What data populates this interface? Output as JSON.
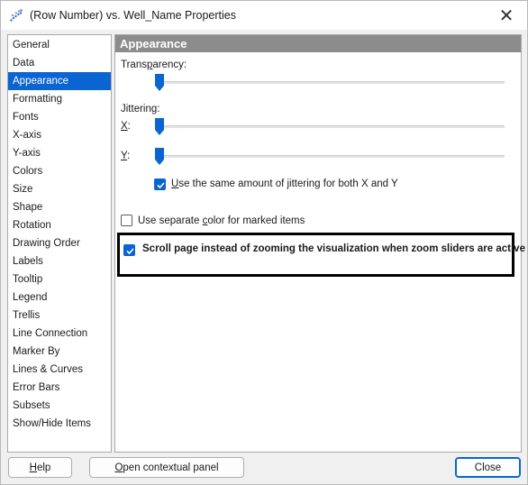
{
  "window": {
    "title": "(Row Number) vs. Well_Name Properties",
    "icon": "scatter-plot-icon",
    "close_glyph": "✕"
  },
  "nav": {
    "items": [
      {
        "label": "General"
      },
      {
        "label": "Data"
      },
      {
        "label": "Appearance",
        "selected": true
      },
      {
        "label": "Formatting"
      },
      {
        "label": "Fonts"
      },
      {
        "label": "X-axis"
      },
      {
        "label": "Y-axis"
      },
      {
        "label": "Colors"
      },
      {
        "label": "Size"
      },
      {
        "label": "Shape"
      },
      {
        "label": "Rotation"
      },
      {
        "label": "Drawing Order"
      },
      {
        "label": "Labels"
      },
      {
        "label": "Tooltip"
      },
      {
        "label": "Legend"
      },
      {
        "label": "Trellis"
      },
      {
        "label": "Line Connection"
      },
      {
        "label": "Marker By"
      },
      {
        "label": "Lines & Curves"
      },
      {
        "label": "Error Bars"
      },
      {
        "label": "Subsets"
      },
      {
        "label": "Show/Hide Items"
      }
    ]
  },
  "panel": {
    "header": "Appearance",
    "transparency": {
      "label_pre": "Trans",
      "label_ul": "p",
      "label_post": "arency:",
      "value": 0
    },
    "jittering": {
      "label": "Jittering:",
      "x_ul": "X",
      "x_post": ":",
      "x_value": 0,
      "y_ul": "Y",
      "y_post": ":",
      "y_value": 0,
      "same_label_ul": "U",
      "same_label_post": "se the same amount of jittering for both X and Y",
      "same_checked": true
    },
    "separate_color": {
      "label_pre": "Use separate ",
      "label_ul": "c",
      "label_post": "olor for marked items",
      "checked": false
    },
    "scroll_page": {
      "label": "Scroll page instead of zooming the visualization when zoom sliders are active",
      "checked": true
    }
  },
  "footer": {
    "help": "Help",
    "help_ul": "H",
    "help_post": "elp",
    "contextual_ul": "O",
    "contextual_post": "pen contextual panel",
    "close": "Close"
  },
  "colors": {
    "accent": "#0a64d2",
    "header_bg": "#8c8c8c"
  }
}
